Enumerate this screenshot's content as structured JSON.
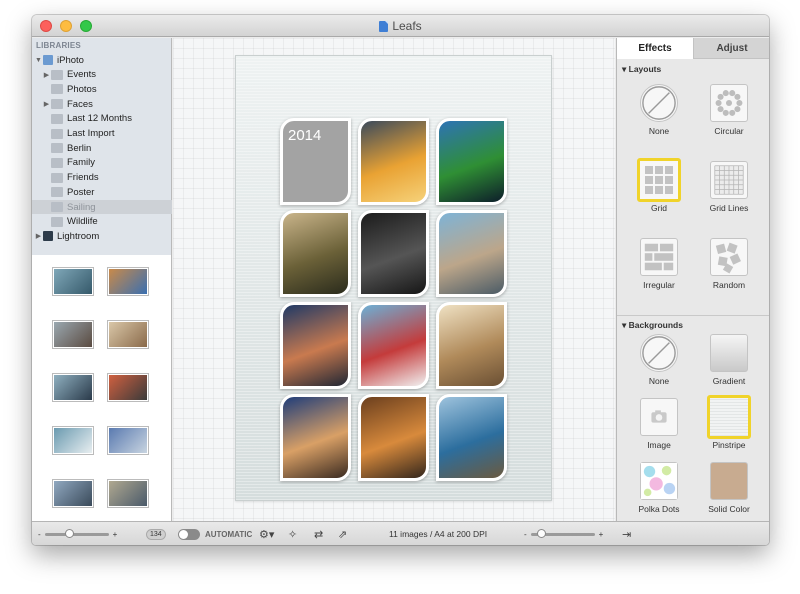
{
  "window": {
    "title": "Leafs"
  },
  "sidebar": {
    "header": "LIBRARIES",
    "items": [
      {
        "label": "iPhoto",
        "level": 0,
        "disclosure": "expanded",
        "icon": "iphoto-icon"
      },
      {
        "label": "Events",
        "level": 1,
        "disclosure": "collapsed",
        "icon": "events-icon"
      },
      {
        "label": "Photos",
        "level": 1,
        "disclosure": "none",
        "icon": "photos-icon"
      },
      {
        "label": "Faces",
        "level": 1,
        "disclosure": "collapsed",
        "icon": "faces-icon"
      },
      {
        "label": "Last 12 Months",
        "level": 1,
        "disclosure": "none",
        "icon": "calendar-icon"
      },
      {
        "label": "Last Import",
        "level": 1,
        "disclosure": "none",
        "icon": "import-icon"
      },
      {
        "label": "Berlin",
        "level": 1,
        "disclosure": "none",
        "icon": "album-icon"
      },
      {
        "label": "Family",
        "level": 1,
        "disclosure": "none",
        "icon": "album-icon"
      },
      {
        "label": "Friends",
        "level": 1,
        "disclosure": "none",
        "icon": "album-icon"
      },
      {
        "label": "Poster",
        "level": 1,
        "disclosure": "none",
        "icon": "album-icon"
      },
      {
        "label": "Sailing",
        "level": 1,
        "disclosure": "none",
        "icon": "album-icon",
        "selected": true
      },
      {
        "label": "Wildlife",
        "level": 1,
        "disclosure": "none",
        "icon": "album-icon"
      },
      {
        "label": "Lightroom",
        "level": 0,
        "disclosure": "collapsed",
        "icon": "lightroom-icon"
      }
    ]
  },
  "thumbnails": [
    {
      "colors": [
        "#7fa7b8",
        "#35596a"
      ]
    },
    {
      "colors": [
        "#c98a4a",
        "#3a6fb0"
      ]
    },
    {
      "colors": [
        "#9aa8b0",
        "#5a4a40"
      ]
    },
    {
      "colors": [
        "#d9c7a8",
        "#8a6a4a"
      ]
    },
    {
      "colors": [
        "#8fb0c0",
        "#2a3a4a"
      ]
    },
    {
      "colors": [
        "#d06040",
        "#3a3a3a"
      ]
    },
    {
      "colors": [
        "#6a9ab0",
        "#e8eef0"
      ]
    },
    {
      "colors": [
        "#5a7ab0",
        "#c8d4e0"
      ]
    },
    {
      "colors": [
        "#90a8c0",
        "#3a4a5a"
      ]
    },
    {
      "colors": [
        "#b0a890",
        "#4a5a6a"
      ]
    }
  ],
  "canvas": {
    "year_label": "2014",
    "photos": [
      {
        "colors": [
          "#3b4a5c",
          "#e9a233",
          "#f6d27a"
        ]
      },
      {
        "colors": [
          "#2d73b5",
          "#2f8f34",
          "#0d1d2a"
        ]
      },
      {
        "colors": [
          "#c9b48a",
          "#6b6138",
          "#2a2b1c"
        ]
      },
      {
        "colors": [
          "#1b1b1b",
          "#555555",
          "#161616"
        ]
      },
      {
        "colors": [
          "#7eb3d6",
          "#bca68a",
          "#4b5b66"
        ]
      },
      {
        "colors": [
          "#1f3966",
          "#c97a4f",
          "#202634"
        ]
      },
      {
        "colors": [
          "#6cb0d6",
          "#c43b3b",
          "#f1f1f1"
        ]
      },
      {
        "colors": [
          "#efe1c3",
          "#b08a5a",
          "#6a4f33"
        ]
      },
      {
        "colors": [
          "#1f3d7a",
          "#d9a066",
          "#3a2a20"
        ]
      },
      {
        "colors": [
          "#6b3f1e",
          "#d88a3c",
          "#33261c"
        ]
      },
      {
        "colors": [
          "#9ec3dd",
          "#2c6e9e",
          "#6b5a3f"
        ]
      }
    ]
  },
  "inspector": {
    "tabs": [
      {
        "label": "Effects",
        "active": true
      },
      {
        "label": "Adjust",
        "active": false
      }
    ],
    "layouts_title": "Layouts",
    "layouts": [
      {
        "label": "None",
        "icon": "none-icon",
        "selected": false
      },
      {
        "label": "Circular",
        "icon": "circular-layout-icon",
        "selected": false
      },
      {
        "label": "Grid",
        "icon": "grid-layout-icon",
        "selected": true
      },
      {
        "label": "Grid Lines",
        "icon": "grid-lines-layout-icon",
        "selected": false
      },
      {
        "label": "Irregular",
        "icon": "irregular-layout-icon",
        "selected": false
      },
      {
        "label": "Random",
        "icon": "random-layout-icon",
        "selected": false
      }
    ],
    "backgrounds_title": "Backgrounds",
    "backgrounds": [
      {
        "label": "None",
        "icon": "none-icon",
        "selected": false
      },
      {
        "label": "Gradient",
        "icon": "gradient-background-icon",
        "selected": false
      },
      {
        "label": "Image",
        "icon": "camera-icon",
        "selected": false
      },
      {
        "label": "Pinstripe",
        "icon": "pinstripe-background-icon",
        "selected": true
      },
      {
        "label": "Polka Dots",
        "icon": "polka-dots-background-icon",
        "selected": false
      },
      {
        "label": "Solid Color",
        "icon": "solid-color-background-icon",
        "selected": false
      }
    ],
    "solid_color": "#c8ab90"
  },
  "bottom": {
    "thumb_zoom_minus": "-",
    "thumb_zoom_plus": "+",
    "thumb_count": "134",
    "automatic_label": "AUTOMATIC",
    "status": "11 images / A4 at 200 DPI",
    "zoom_minus": "-",
    "zoom_plus": "+"
  }
}
